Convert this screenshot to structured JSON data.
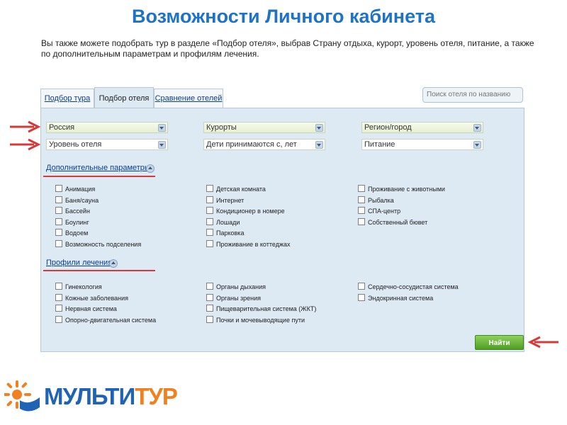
{
  "slide": {
    "title": "Возможности Личного кабинета",
    "description": "Вы также можете подобрать тур в разделе «Подбор отеля», выбрав Страну отдыха, курорт, уровень отеля, питание, а также по дополнительным параметрам и профилям лечения."
  },
  "tabs": [
    {
      "label": "Подбор тура"
    },
    {
      "label": "Подбор отеля"
    },
    {
      "label": "Сравнение отелей"
    }
  ],
  "search": {
    "placeholder": "Поиск отеля по названию"
  },
  "filters": {
    "country": "Россия",
    "resorts": "Курорты",
    "region": "Регион/город",
    "hotel_level": "Уровень отеля",
    "children": "Дети принимаются с, лет",
    "meals": "Питание"
  },
  "extra_params": {
    "title": "Дополнительные параметры:",
    "col1": [
      "Анимация",
      "Баня/сауна",
      "Бассейн",
      "Боулинг",
      "Водоем",
      "Возможность подселения"
    ],
    "col2": [
      "Детская комната",
      "Интернет",
      "Кондиционер в номере",
      "Лошади",
      "Парковка",
      "Проживание в коттеджах"
    ],
    "col3": [
      "Проживание с животными",
      "Рыбалка",
      "СПА-центр",
      "Собственный бювет"
    ]
  },
  "treatment": {
    "title": "Профили лечения:",
    "col1": [
      "Гинекология",
      "Кожные заболевания",
      "Нервная система",
      "Опорно-двигательная система"
    ],
    "col2": [
      "Органы дыхания",
      "Органы зрения",
      "Пищеварительная система (ЖКТ)",
      "Почки и мочевыводящие пути"
    ],
    "col3": [
      "Сердечно-сосудистая система",
      "Эндокринная система"
    ]
  },
  "find_button": {
    "label": "Найти"
  },
  "logo": {
    "part1": "МУЛЬТИ",
    "part2": "ТУР"
  },
  "colors": {
    "accent": "#1f73c6",
    "panel_bg": "#dde9f3",
    "arrow": "#d43a3a",
    "button": "#4f9e23",
    "logo_orange": "#f08020"
  }
}
